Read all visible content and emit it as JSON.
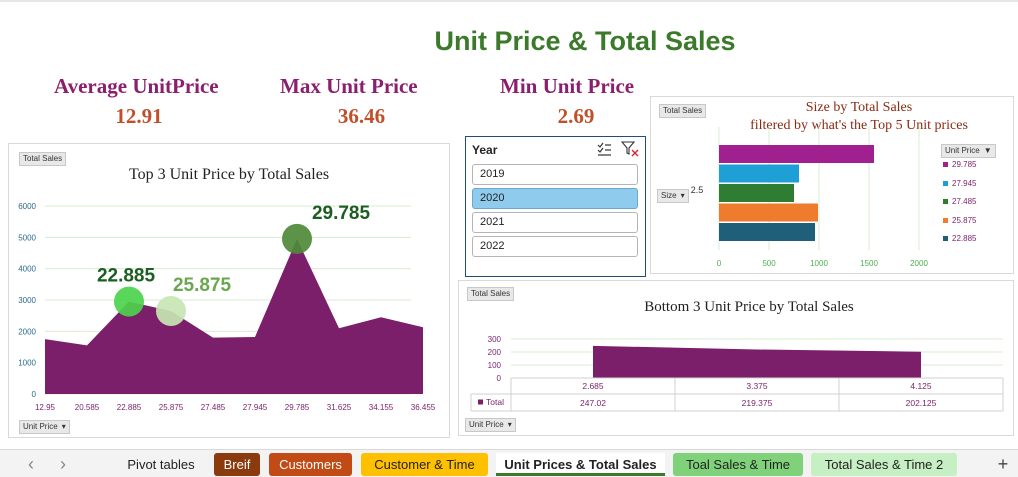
{
  "title": "Unit Price & Total Sales",
  "kpis": {
    "avg_label": "Average UnitPrice",
    "avg_value": "12.91",
    "max_label": "Max Unit Price",
    "max_value": "36.46",
    "min_label": "Min Unit Price",
    "min_value": "2.69"
  },
  "slicer": {
    "header": "Year",
    "items": [
      "2019",
      "2020",
      "2021",
      "2022"
    ],
    "selected": "2020"
  },
  "field_buttons": {
    "total_sales": "Total Sales",
    "unit_price": "Unit Price",
    "size": "Size"
  },
  "tabs": {
    "items": [
      "Pivot tables",
      "Breif",
      "Customers",
      "Customer & Time",
      "Unit Prices & Total Sales",
      "Toal Sales & Time",
      "Total Sales & Time 2"
    ],
    "active": "Unit Prices & Total Sales",
    "add": "+",
    "prev": "‹",
    "next": "›"
  },
  "colors": {
    "purple": "#7b1f6b",
    "title_green": "#3a7a2a",
    "kpi_label": "#8b1f6e",
    "kpi_value": "#c0502a",
    "slicer_selected": "#8ecbed"
  },
  "chart_data": [
    {
      "type": "area",
      "title": "Top 3 Unit Price by Total Sales",
      "categories": [
        "12.95",
        "20.585",
        "22.885",
        "25.875",
        "27.485",
        "27.945",
        "29.785",
        "31.625",
        "34.155",
        "36.455"
      ],
      "values": [
        1750,
        1550,
        2950,
        2650,
        1800,
        1820,
        4950,
        2100,
        2450,
        2130
      ],
      "ylim": [
        0,
        6000
      ],
      "yticks": [
        0,
        1000,
        2000,
        3000,
        4000,
        5000,
        6000
      ],
      "grid": true,
      "highlights": [
        {
          "category": "22.885",
          "label": "22.885",
          "color": "#4cd34c",
          "text_color": "#1b5e20"
        },
        {
          "category": "25.875",
          "label": "25.875",
          "color": "#c8e6b4",
          "text_color": "#6aa84f"
        },
        {
          "category": "29.785",
          "label": "29.785",
          "color": "#4e8a3a",
          "text_color": "#1b5e20"
        }
      ]
    },
    {
      "type": "bar",
      "title": "Size by Total Sales",
      "subtitle": "filtered by what's the Top 5 Unit prices",
      "category": "2.5",
      "legend_title": "Unit Price",
      "legend_position": "right",
      "series": [
        {
          "name": "29.785",
          "value": 1550,
          "color": "#a1208f"
        },
        {
          "name": "27.945",
          "value": 800,
          "color": "#1e9fd6"
        },
        {
          "name": "27.485",
          "value": 750,
          "color": "#2e7d32"
        },
        {
          "name": "25.875",
          "value": 990,
          "color": "#ef7b2d"
        },
        {
          "name": "22.885",
          "value": 960,
          "color": "#1f5f7a"
        }
      ],
      "xlim": [
        0,
        2000
      ],
      "xticks": [
        0,
        500,
        1000,
        1500,
        2000
      ],
      "grid": true
    },
    {
      "type": "area",
      "title": "Bottom  3 Unit Price by Total Sales",
      "categories": [
        "2.685",
        "3.375",
        "4.125"
      ],
      "values": [
        247.02,
        219.375,
        202.125
      ],
      "value_labels": [
        "247.02",
        "219.375",
        "202.125"
      ],
      "series_name": "Total",
      "ylim": [
        0,
        300
      ],
      "yticks": [
        0,
        100,
        200,
        300
      ],
      "grid": true
    }
  ]
}
